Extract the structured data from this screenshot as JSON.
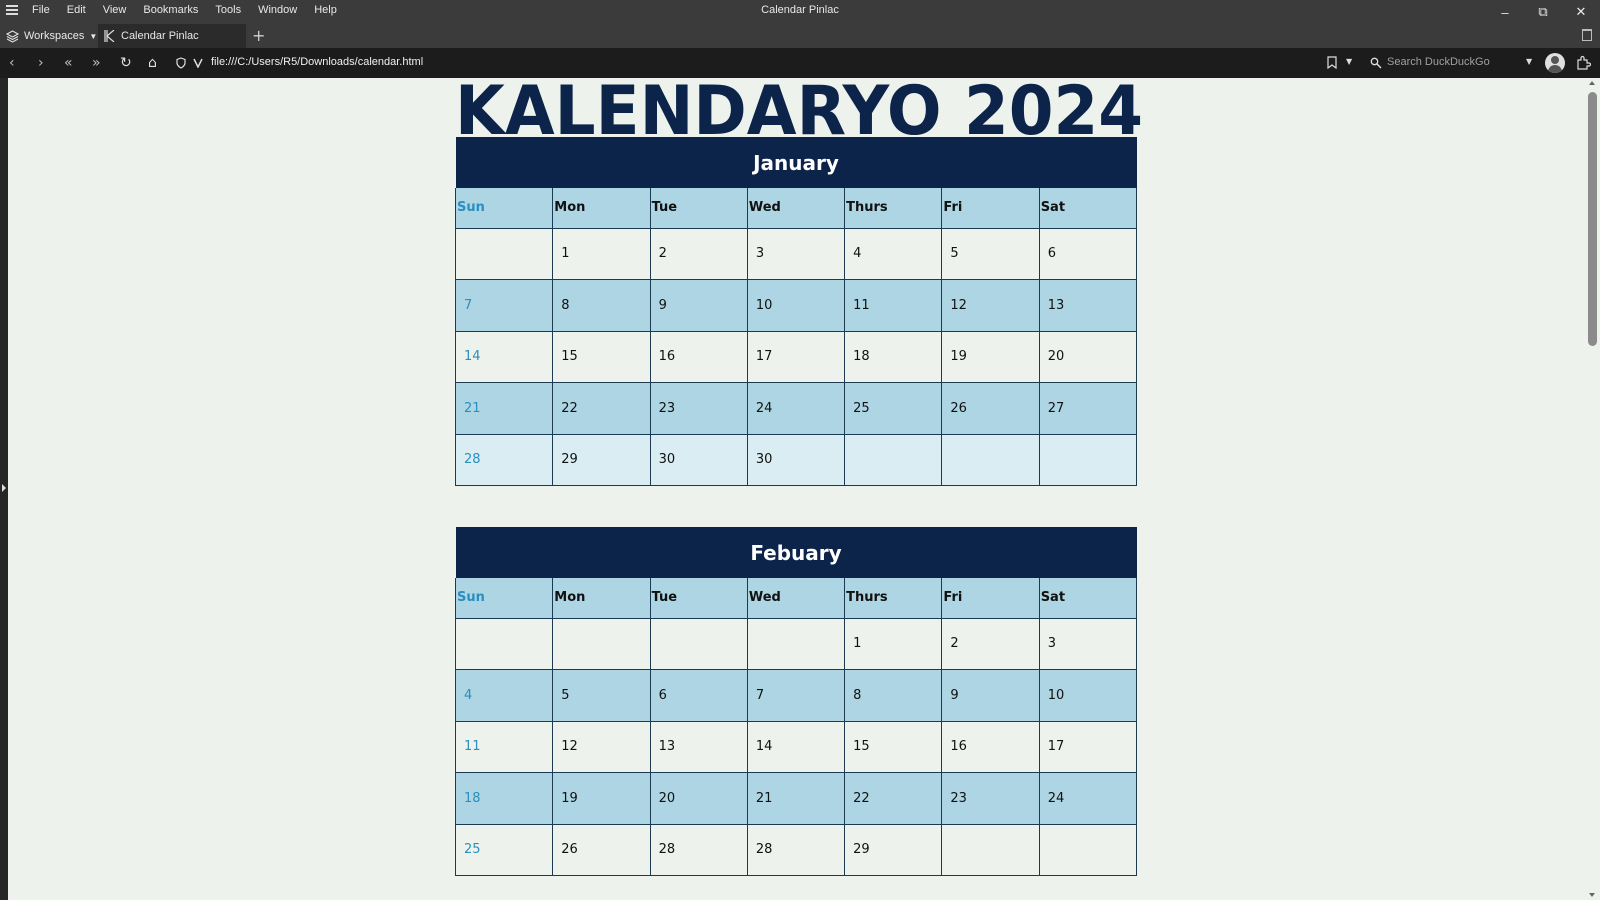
{
  "browser": {
    "window_title": "Calendar Pinlac",
    "menu": [
      "File",
      "Edit",
      "View",
      "Bookmarks",
      "Tools",
      "Window",
      "Help"
    ],
    "workspaces_label": "Workspaces",
    "tab_title": "Calendar Pinlac",
    "url": "file:///C:/Users/R5/Downloads/calendar.html",
    "search_placeholder": "Search DuckDuckGo"
  },
  "page": {
    "heading": "KALENDARYO 2024",
    "months": [
      {
        "name": "January",
        "days_of_week": [
          "Sun",
          "Mon",
          "Tue",
          "Wed",
          "Thurs",
          "Fri",
          "Sat"
        ],
        "weeks": [
          [
            "",
            "1",
            "2",
            "3",
            "4",
            "5",
            "6"
          ],
          [
            "7",
            "8",
            "9",
            "10",
            "11",
            "12",
            "13"
          ],
          [
            "14",
            "15",
            "16",
            "17",
            "18",
            "19",
            "20"
          ],
          [
            "21",
            "22",
            "23",
            "24",
            "25",
            "26",
            "27"
          ],
          [
            "28",
            "29",
            "30",
            "30",
            "",
            "",
            ""
          ]
        ]
      },
      {
        "name": "Febuary",
        "days_of_week": [
          "Sun",
          "Mon",
          "Tue",
          "Wed",
          "Thurs",
          "Fri",
          "Sat"
        ],
        "weeks": [
          [
            "",
            "",
            "",
            "",
            "1",
            "2",
            "3"
          ],
          [
            "4",
            "5",
            "6",
            "7",
            "8",
            "9",
            "10"
          ],
          [
            "11",
            "12",
            "13",
            "14",
            "15",
            "16",
            "17"
          ],
          [
            "18",
            "19",
            "20",
            "21",
            "22",
            "23",
            "24"
          ],
          [
            "25",
            "26",
            "28",
            "28",
            "29",
            "",
            ""
          ]
        ]
      }
    ]
  },
  "colors": {
    "header_navy": "#0c2449",
    "light_blue": "#add5e3",
    "sunday_blue": "#2a8fbf",
    "page_bg": "#eef2ec"
  }
}
